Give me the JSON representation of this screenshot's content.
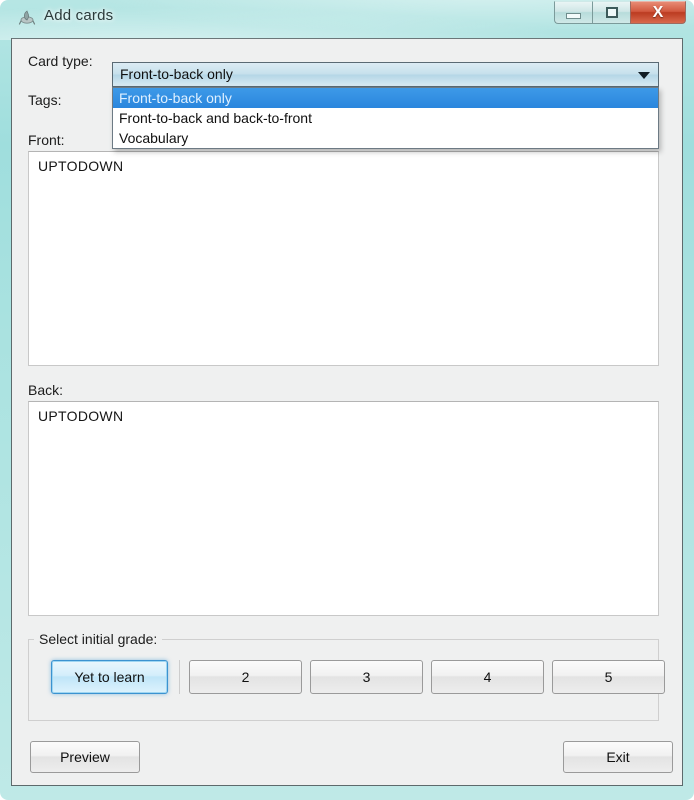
{
  "window": {
    "title": "Add cards",
    "app_icon": "add-cards-icon",
    "controls": {
      "minimize": "minimize-icon",
      "maximize": "maximize-icon",
      "close": "X"
    },
    "colors": {
      "frame": "#a9e2e0",
      "close_button": "#c6462a",
      "selection_blue": "#2a86dd",
      "focus_blue": "#3c93d0",
      "client_background": "#eff0f0"
    }
  },
  "form": {
    "labels": {
      "card_type": "Card type:",
      "tags": "Tags:",
      "front": "Front:",
      "back": "Back:"
    },
    "card_type": {
      "selected": "Front-to-back only",
      "expanded": true,
      "arrow_icon": "chevron-down-icon",
      "options": [
        {
          "label": "Front-to-back only",
          "selected": true
        },
        {
          "label": "Front-to-back and back-to-front",
          "selected": false
        },
        {
          "label": "Vocabulary",
          "selected": false
        }
      ]
    },
    "tags": {
      "value": ""
    },
    "front": {
      "value": "UPTODOWN"
    },
    "back": {
      "value": "UPTODOWN"
    }
  },
  "grade": {
    "legend": "Select initial grade:",
    "buttons": [
      {
        "label": "Yet to learn",
        "focused": true
      },
      {
        "label": "2",
        "focused": false
      },
      {
        "label": "3",
        "focused": false
      },
      {
        "label": "4",
        "focused": false
      },
      {
        "label": "5",
        "focused": false
      }
    ]
  },
  "footer": {
    "preview_label": "Preview",
    "exit_label": "Exit"
  }
}
